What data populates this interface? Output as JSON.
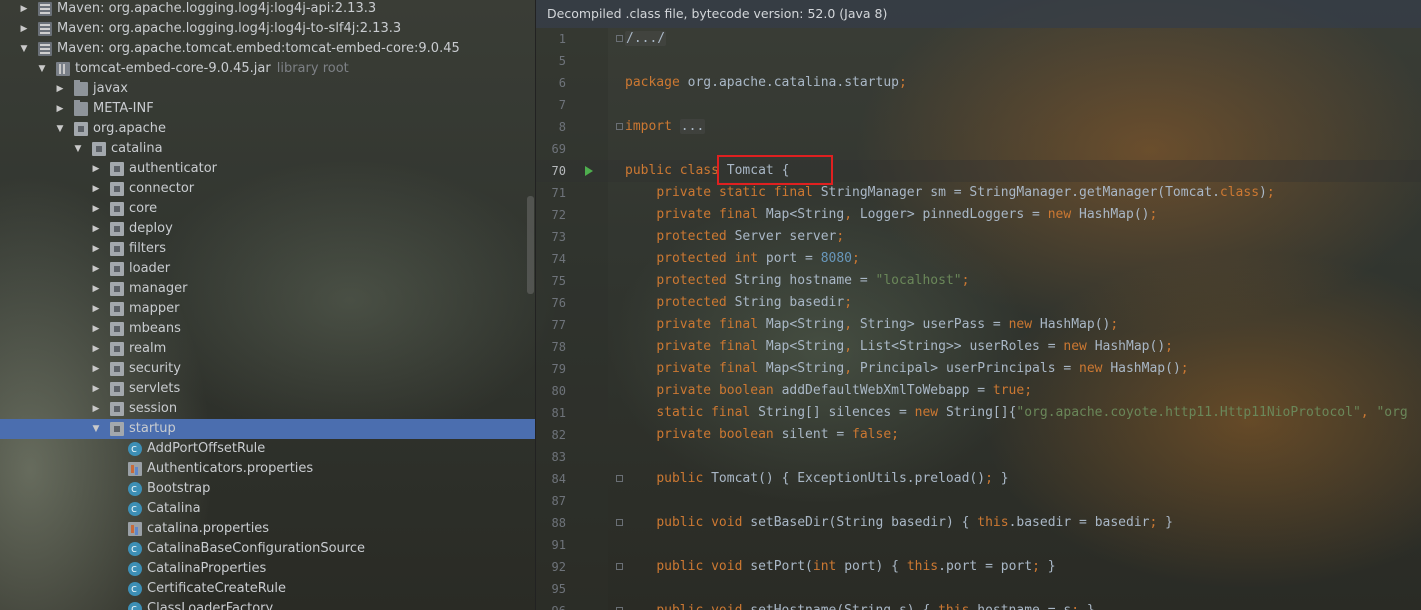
{
  "tree": {
    "items": [
      {
        "label": "Maven: org.apache.logging.log4j:log4j-api:2.13.3",
        "icon": "library-icon",
        "expanded": false
      },
      {
        "label": "Maven: org.apache.logging.log4j:log4j-to-slf4j:2.13.3",
        "icon": "library-icon",
        "expanded": false
      },
      {
        "label": "Maven: org.apache.tomcat.embed:tomcat-embed-core:9.0.45",
        "icon": "library-icon",
        "expanded": true
      },
      {
        "label": "tomcat-embed-core-9.0.45.jar",
        "hint": "library root",
        "icon": "jar-icon",
        "expanded": true
      },
      {
        "label": "javax",
        "icon": "folder-icon",
        "expanded": false
      },
      {
        "label": "META-INF",
        "icon": "folder-icon",
        "expanded": false
      },
      {
        "label": "org.apache",
        "icon": "package-icon",
        "expanded": true
      },
      {
        "label": "catalina",
        "icon": "package-icon",
        "expanded": true
      },
      {
        "label": "authenticator",
        "icon": "package-icon",
        "expanded": false
      },
      {
        "label": "connector",
        "icon": "package-icon",
        "expanded": false
      },
      {
        "label": "core",
        "icon": "package-icon",
        "expanded": false
      },
      {
        "label": "deploy",
        "icon": "package-icon",
        "expanded": false
      },
      {
        "label": "filters",
        "icon": "package-icon",
        "expanded": false
      },
      {
        "label": "loader",
        "icon": "package-icon",
        "expanded": false
      },
      {
        "label": "manager",
        "icon": "package-icon",
        "expanded": false
      },
      {
        "label": "mapper",
        "icon": "package-icon",
        "expanded": false
      },
      {
        "label": "mbeans",
        "icon": "package-icon",
        "expanded": false
      },
      {
        "label": "realm",
        "icon": "package-icon",
        "expanded": false
      },
      {
        "label": "security",
        "icon": "package-icon",
        "expanded": false
      },
      {
        "label": "servlets",
        "icon": "package-icon",
        "expanded": false
      },
      {
        "label": "session",
        "icon": "package-icon",
        "expanded": false
      },
      {
        "label": "startup",
        "icon": "package-icon",
        "expanded": true,
        "selected": true
      },
      {
        "label": "AddPortOffsetRule",
        "icon": "class-icon"
      },
      {
        "label": "Authenticators.properties",
        "icon": "properties-icon"
      },
      {
        "label": "Bootstrap",
        "icon": "class-icon"
      },
      {
        "label": "Catalina",
        "icon": "class-icon"
      },
      {
        "label": "catalina.properties",
        "icon": "properties-icon"
      },
      {
        "label": "CatalinaBaseConfigurationSource",
        "icon": "class-icon"
      },
      {
        "label": "CatalinaProperties",
        "icon": "class-icon"
      },
      {
        "label": "CertificateCreateRule",
        "icon": "class-icon"
      },
      {
        "label": "ClassLoaderFactory",
        "icon": "class-icon"
      }
    ]
  },
  "editor": {
    "banner": "Decompiled .class file, bytecode version: 52.0 (Java 8)",
    "lines": [
      {
        "num": "1",
        "text": "/.../",
        "fold": true
      },
      {
        "num": "5",
        "text": ""
      },
      {
        "num": "6",
        "text": "package org.apache.catalina.startup;"
      },
      {
        "num": "7",
        "text": ""
      },
      {
        "num": "8",
        "text": "import ...",
        "fold": true
      },
      {
        "num": "69",
        "text": ""
      },
      {
        "num": "70",
        "text": "public class Tomcat {",
        "run": true,
        "current": true
      },
      {
        "num": "71",
        "text": "    private static final StringManager sm = StringManager.getManager(Tomcat.class);"
      },
      {
        "num": "72",
        "text": "    private final Map<String, Logger> pinnedLoggers = new HashMap();"
      },
      {
        "num": "73",
        "text": "    protected Server server;"
      },
      {
        "num": "74",
        "text": "    protected int port = 8080;"
      },
      {
        "num": "75",
        "text": "    protected String hostname = \"localhost\";"
      },
      {
        "num": "76",
        "text": "    protected String basedir;"
      },
      {
        "num": "77",
        "text": "    private final Map<String, String> userPass = new HashMap();"
      },
      {
        "num": "78",
        "text": "    private final Map<String, List<String>> userRoles = new HashMap();"
      },
      {
        "num": "79",
        "text": "    private final Map<String, Principal> userPrincipals = new HashMap();"
      },
      {
        "num": "80",
        "text": "    private boolean addDefaultWebXmlToWebapp = true;"
      },
      {
        "num": "81",
        "text": "    static final String[] silences = new String[]{\"org.apache.coyote.http11.Http11NioProtocol\", \"org"
      },
      {
        "num": "82",
        "text": "    private boolean silent = false;"
      },
      {
        "num": "83",
        "text": ""
      },
      {
        "num": "84",
        "text": "    public Tomcat() { ExceptionUtils.preload(); }",
        "fold": true
      },
      {
        "num": "87",
        "text": ""
      },
      {
        "num": "88",
        "text": "    public void setBaseDir(String basedir) { this.basedir = basedir; }",
        "fold": true
      },
      {
        "num": "91",
        "text": ""
      },
      {
        "num": "92",
        "text": "    public void setPort(int port) { this.port = port; }",
        "fold": true
      },
      {
        "num": "95",
        "text": ""
      },
      {
        "num": "96",
        "text": "    public void setHostname(String s) { this.hostname = s; }",
        "fold": true
      }
    ]
  }
}
